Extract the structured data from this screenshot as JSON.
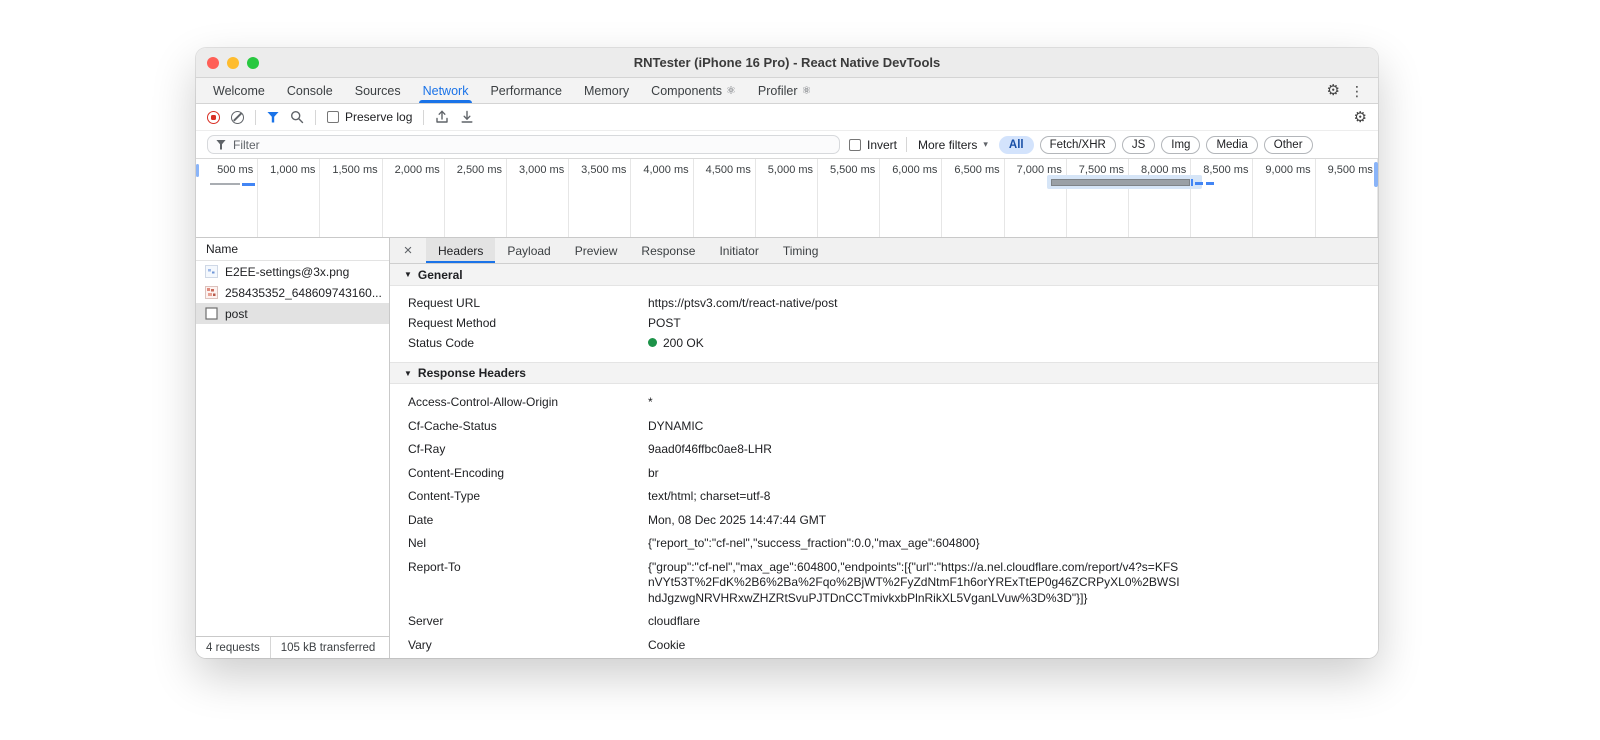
{
  "colors": {
    "accent_blue": "#1a73e8",
    "record_red": "#d93025",
    "status_green": "#1d9349",
    "active_pill_bg": "#d3e3fc",
    "traffic_red": "#ff5f57",
    "traffic_yellow": "#febc2e",
    "traffic_green": "#28c840",
    "waterfall_gray": "#9aa0a6",
    "waterfall_highlight": "#d6e5f7"
  },
  "icons": {
    "settings": "⚙",
    "kebab": "⋮",
    "atom": "⚛",
    "close": "×",
    "caret_down": "▾",
    "section_triangle": "▼"
  },
  "window": {
    "title": "RNTester (iPhone 16 Pro) - React Native DevTools"
  },
  "devtools_tabs": {
    "active": "Network",
    "items": [
      {
        "label": "Welcome"
      },
      {
        "label": "Console"
      },
      {
        "label": "Sources"
      },
      {
        "label": "Network"
      },
      {
        "label": "Performance"
      },
      {
        "label": "Memory"
      },
      {
        "label": "Components"
      },
      {
        "label": "Profiler"
      }
    ]
  },
  "network_toolbar": {
    "preserve_log_label": "Preserve log"
  },
  "filter_bar": {
    "placeholder": "Filter",
    "invert_label": "Invert",
    "more_filters_label": "More filters",
    "active_pill": "All",
    "pills": [
      "All",
      "Fetch/XHR",
      "JS",
      "Img",
      "Media",
      "Other"
    ]
  },
  "timeline": {
    "ticks": [
      "500 ms",
      "1,000 ms",
      "1,500 ms",
      "2,000 ms",
      "2,500 ms",
      "3,000 ms",
      "3,500 ms",
      "4,000 ms",
      "4,500 ms",
      "5,000 ms",
      "5,500 ms",
      "6,000 ms",
      "6,500 ms",
      "7,000 ms",
      "7,500 ms",
      "8,000 ms",
      "8,500 ms",
      "9,000 ms",
      "9,500 ms"
    ]
  },
  "requests": {
    "column_header": "Name",
    "items": [
      {
        "name": "E2EE-settings@3x.png",
        "icon": "image-thumbnail",
        "selected": false
      },
      {
        "name": "258435352_648609743160...",
        "icon": "image-thumbnail",
        "selected": false
      },
      {
        "name": "post",
        "icon": "document",
        "selected": true
      }
    ]
  },
  "details": {
    "active_tab": "Headers",
    "tabs": [
      {
        "label": "Headers"
      },
      {
        "label": "Payload"
      },
      {
        "label": "Preview"
      },
      {
        "label": "Response"
      },
      {
        "label": "Initiator"
      },
      {
        "label": "Timing"
      }
    ],
    "general": {
      "title": "General",
      "rows": [
        {
          "name": "Request URL",
          "value": "https://ptsv3.com/t/react-native/post"
        },
        {
          "name": "Request Method",
          "value": "POST"
        },
        {
          "name": "Status Code",
          "value": "200 OK"
        }
      ]
    },
    "response_headers": {
      "title": "Response Headers",
      "rows": [
        {
          "name": "Access-Control-Allow-Origin",
          "value": "*"
        },
        {
          "name": "Cf-Cache-Status",
          "value": "DYNAMIC"
        },
        {
          "name": "Cf-Ray",
          "value": "9aad0f46ffbc0ae8-LHR"
        },
        {
          "name": "Content-Encoding",
          "value": "br"
        },
        {
          "name": "Content-Type",
          "value": "text/html; charset=utf-8"
        },
        {
          "name": "Date",
          "value": "Mon, 08 Dec 2025 14:47:44 GMT"
        },
        {
          "name": "Nel",
          "value": "{\"report_to\":\"cf-nel\",\"success_fraction\":0.0,\"max_age\":604800}"
        },
        {
          "name": "Report-To",
          "value": "{\"group\":\"cf-nel\",\"max_age\":604800,\"endpoints\":[{\"url\":\"https://a.nel.cloudflare.com/report/v4?s=KFSnVYt53T%2FdK%2B6%2Ba%2Fqo%2BjWT%2FyZdNtmF1h6orYRExTtEP0g46ZCRPyXL0%2BWSIhdJgzwgNRVHRxwZHZRtSvuPJTDnCCTmivkxbPlnRikXL5VganLVuw%3D%3D\"}]}"
        },
        {
          "name": "Server",
          "value": "cloudflare"
        },
        {
          "name": "Vary",
          "value": "Cookie"
        }
      ]
    }
  },
  "status_bar": {
    "requests": "4 requests",
    "transferred": "105 kB transferred"
  }
}
